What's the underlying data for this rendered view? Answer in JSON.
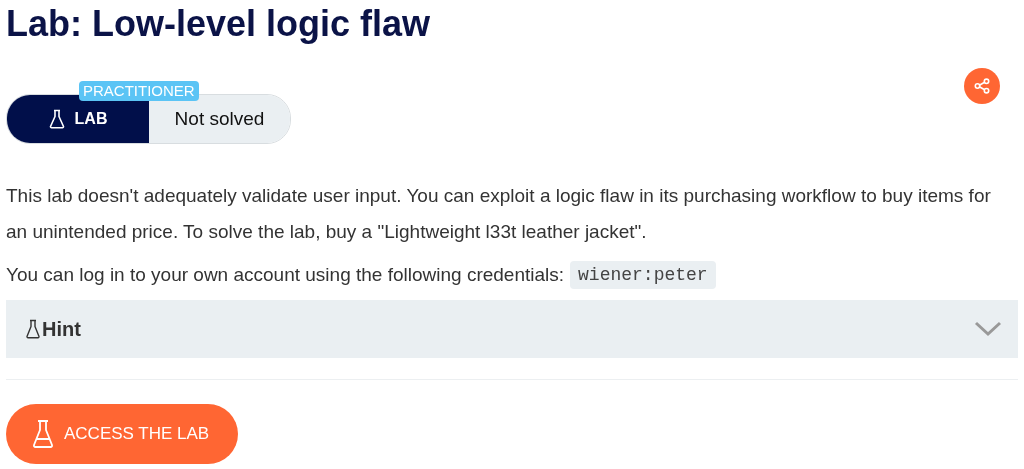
{
  "title": "Lab: Low-level logic flaw",
  "level_badge": "PRACTITIONER",
  "lab_pill": {
    "label": "LAB",
    "status": "Not solved"
  },
  "description": "This lab doesn't adequately validate user input. You can exploit a logic flaw in its purchasing workflow to buy items for an unintended price. To solve the lab, buy a \"Lightweight l33t leather jacket\".",
  "credentials": {
    "text": "You can log in to your own account using the following credentials:",
    "code": "wiener:peter"
  },
  "hint": {
    "label": "Hint",
    "expanded": false
  },
  "access_button": "ACCESS THE LAB"
}
